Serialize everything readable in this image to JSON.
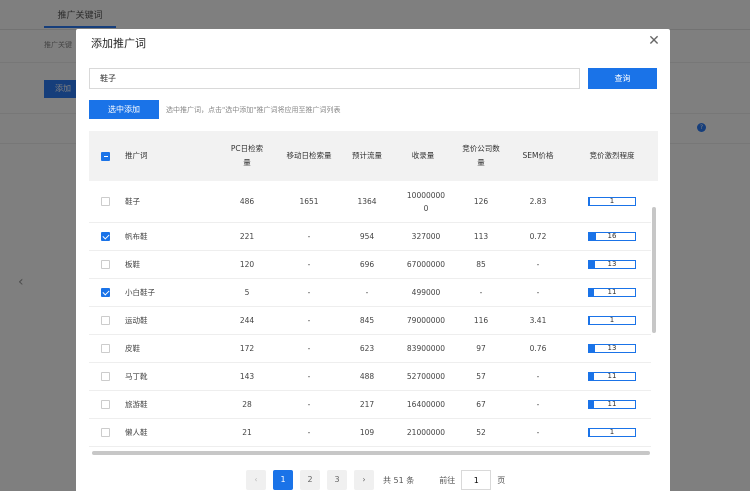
{
  "background": {
    "tab_label": "推广关键词",
    "sub_label": "推广关键",
    "add_button": "添加"
  },
  "modal": {
    "title": "添加推广词",
    "search": {
      "value": "鞋子",
      "button": "查询"
    },
    "select_add_button": "选中添加",
    "hint": "选中推广词，点击\"选中添加\"推广词将应用至推广词列表",
    "columns": [
      "推广词",
      "PC日检索量",
      "移动日检索量",
      "预计流量",
      "收录量",
      "竞价公司数量",
      "SEM价格",
      "竞价激烈程度"
    ],
    "rows": [
      {
        "checked": false,
        "keyword": "鞋子",
        "pc": "486",
        "mobile": "1651",
        "flow": "1364",
        "index": "100000000",
        "companies": "126",
        "sem": "2.83",
        "competition": 1
      },
      {
        "checked": true,
        "keyword": "帆布鞋",
        "pc": "221",
        "mobile": "-",
        "flow": "954",
        "index": "327000",
        "companies": "113",
        "sem": "0.72",
        "competition": 16
      },
      {
        "checked": false,
        "keyword": "板鞋",
        "pc": "120",
        "mobile": "-",
        "flow": "696",
        "index": "67000000",
        "companies": "85",
        "sem": "-",
        "competition": 13
      },
      {
        "checked": true,
        "keyword": "小白鞋子",
        "pc": "5",
        "mobile": "-",
        "flow": "-",
        "index": "499000",
        "companies": "-",
        "sem": "-",
        "competition": 11
      },
      {
        "checked": false,
        "keyword": "运动鞋",
        "pc": "244",
        "mobile": "-",
        "flow": "845",
        "index": "79000000",
        "companies": "116",
        "sem": "3.41",
        "competition": 1
      },
      {
        "checked": false,
        "keyword": "皮鞋",
        "pc": "172",
        "mobile": "-",
        "flow": "623",
        "index": "83900000",
        "companies": "97",
        "sem": "0.76",
        "competition": 13
      },
      {
        "checked": false,
        "keyword": "马丁靴",
        "pc": "143",
        "mobile": "-",
        "flow": "488",
        "index": "52700000",
        "companies": "57",
        "sem": "-",
        "competition": 11
      },
      {
        "checked": false,
        "keyword": "旅游鞋",
        "pc": "28",
        "mobile": "-",
        "flow": "217",
        "index": "16400000",
        "companies": "67",
        "sem": "-",
        "competition": 11
      },
      {
        "checked": false,
        "keyword": "懒人鞋",
        "pc": "21",
        "mobile": "-",
        "flow": "109",
        "index": "21000000",
        "companies": "52",
        "sem": "-",
        "competition": 1
      }
    ],
    "pagination": {
      "prev": "‹",
      "pages": [
        "1",
        "2",
        "3"
      ],
      "current": "1",
      "next": "›",
      "total": "共 51 条",
      "goto_label": "前往",
      "goto_value": "1",
      "goto_unit": "页"
    }
  },
  "colors": {
    "accent": "#1a73e8"
  },
  "icons": {
    "close": "close-icon",
    "prev": "chevron-left-icon",
    "next": "chevron-right-icon"
  }
}
